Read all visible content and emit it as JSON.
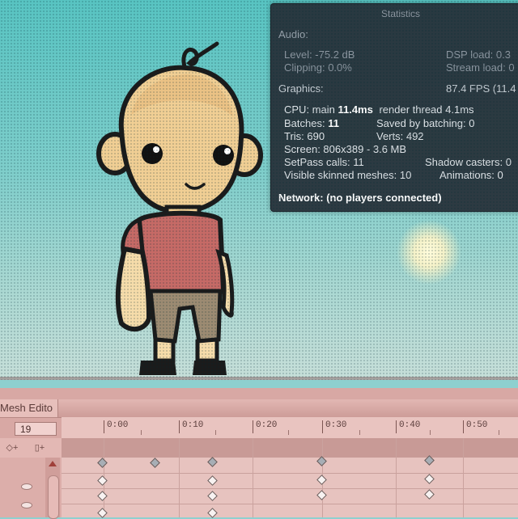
{
  "stats_panel": {
    "title": "Statistics",
    "audio_header": "Audio:",
    "level": "Level: -75.2 dB",
    "dsp_load": "DSP load: 0.3",
    "clipping": "Clipping: 0.0%",
    "stream_load": "Stream load: 0",
    "graphics_header": "Graphics:",
    "fps": "87.4 FPS (11.4",
    "cpu_prefix": "CPU: main ",
    "cpu_main": "11.4ms",
    "cpu_render": "render thread 4.1ms",
    "batches_prefix": "Batches: ",
    "batches_value": "11",
    "saved_batching": "Saved by batching: 0",
    "tris": "Tris: 690",
    "verts": "Verts: 492",
    "screen": "Screen: 806x389 - 3.6 MB",
    "setpass": "SetPass calls: 11",
    "shadow_casters": "Shadow casters: 0",
    "skinned_meshes": "Visible skinned meshes: 10",
    "animations": "Animations: 0",
    "network": "Network: (no players connected)"
  },
  "editor": {
    "tab_label": "Mesh Edito",
    "frame_value": "19",
    "ruler_labels": [
      "0:00",
      "0:10",
      "0:20",
      "0:30",
      "0:40",
      "0:50"
    ],
    "add_keyframe_icon": "add-keyframe-icon",
    "add_event_icon": "add-event-icon"
  },
  "colors": {
    "viewport_sky": "#6ecbc8",
    "stats_bg": "#262e37",
    "editor_bg": "#d8a8a4"
  }
}
